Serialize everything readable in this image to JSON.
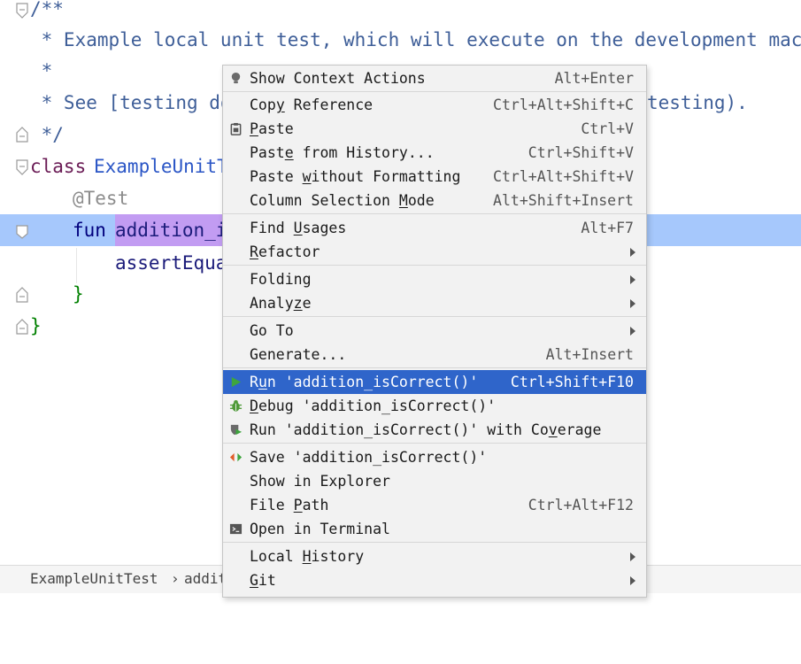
{
  "editor": {
    "lines": {
      "l0": "/**",
      "l1": " * Example local unit test, which will execute on the development machine",
      "l2": " *",
      "l3a": " * See [testing do",
      "l3b": "testing).",
      "l4": " */",
      "l5_kw": "class",
      "l5_name": "ExampleUnitT",
      "l6": "@Test",
      "l7_kw": "fun",
      "l7_name": "addition_i",
      "l8": "assertEqua",
      "l9": "}",
      "l10": "}"
    }
  },
  "breadcrumb": {
    "class_name": "ExampleUnitTest",
    "separator": "›",
    "method": "addit"
  },
  "menu": {
    "show_context_actions": {
      "label": "Show Context Actions",
      "shortcut": "Alt+Enter"
    },
    "copy_reference": {
      "label_pre": "Cop",
      "label_u": "y",
      "label_post": " Reference",
      "shortcut": "Ctrl+Alt+Shift+C"
    },
    "paste": {
      "label_u": "P",
      "label_post": "aste",
      "shortcut": "Ctrl+V"
    },
    "paste_from_history": {
      "label_pre": "Past",
      "label_u": "e",
      "label_post": " from History...",
      "shortcut": "Ctrl+Shift+V"
    },
    "paste_without_formatting": {
      "label_pre": "Paste ",
      "label_u": "w",
      "label_post": "ithout Formatting",
      "shortcut": "Ctrl+Alt+Shift+V"
    },
    "column_selection_mode": {
      "label_pre": "Column Selection ",
      "label_u": "M",
      "label_post": "ode",
      "shortcut": "Alt+Shift+Insert"
    },
    "find_usages": {
      "label_pre": "Find ",
      "label_u": "U",
      "label_post": "sages",
      "shortcut": "Alt+F7"
    },
    "refactor": {
      "label_u": "R",
      "label_post": "efactor"
    },
    "folding": {
      "label": "Folding"
    },
    "analyze": {
      "label_pre": "Analy",
      "label_u": "z",
      "label_post": "e"
    },
    "go_to": {
      "label": "Go To"
    },
    "generate": {
      "label": "Generate...",
      "shortcut": "Alt+Insert"
    },
    "run": {
      "label_pre": "R",
      "label_u": "u",
      "label_post": "n 'addition_isCorrect()'",
      "shortcut": "Ctrl+Shift+F10"
    },
    "debug": {
      "label_u": "D",
      "label_post": "ebug 'addition_isCorrect()'"
    },
    "run_coverage": {
      "label_pre": "Run 'addition_isCorrect()' with Co",
      "label_u": "v",
      "label_post": "erage"
    },
    "save": {
      "label": "Save 'addition_isCorrect()'"
    },
    "show_in_explorer": {
      "label": "Show in Explorer"
    },
    "file_path": {
      "label_pre": "File ",
      "label_u": "P",
      "label_post": "ath",
      "shortcut": "Ctrl+Alt+F12"
    },
    "open_in_terminal": {
      "label": "Open in Terminal"
    },
    "local_history": {
      "label_pre": "Local ",
      "label_u": "H",
      "label_post": "istory"
    },
    "git": {
      "label_u": "G",
      "label_post": "it"
    }
  },
  "colors": {
    "menu_highlight": "#2f65ca",
    "caret_row": "#a6c8fc",
    "identifier_highlight": "#c29cf2",
    "run_icon": "#3ea53e",
    "debug_icon": "#4e9a38"
  },
  "icons": {
    "show_context_actions": "lightbulb-icon",
    "paste": "clipboard-icon",
    "run": "play-icon",
    "debug": "bug-icon",
    "run_coverage": "coverage-icon",
    "save": "save-config-icon",
    "open_in_terminal": "terminal-icon"
  }
}
